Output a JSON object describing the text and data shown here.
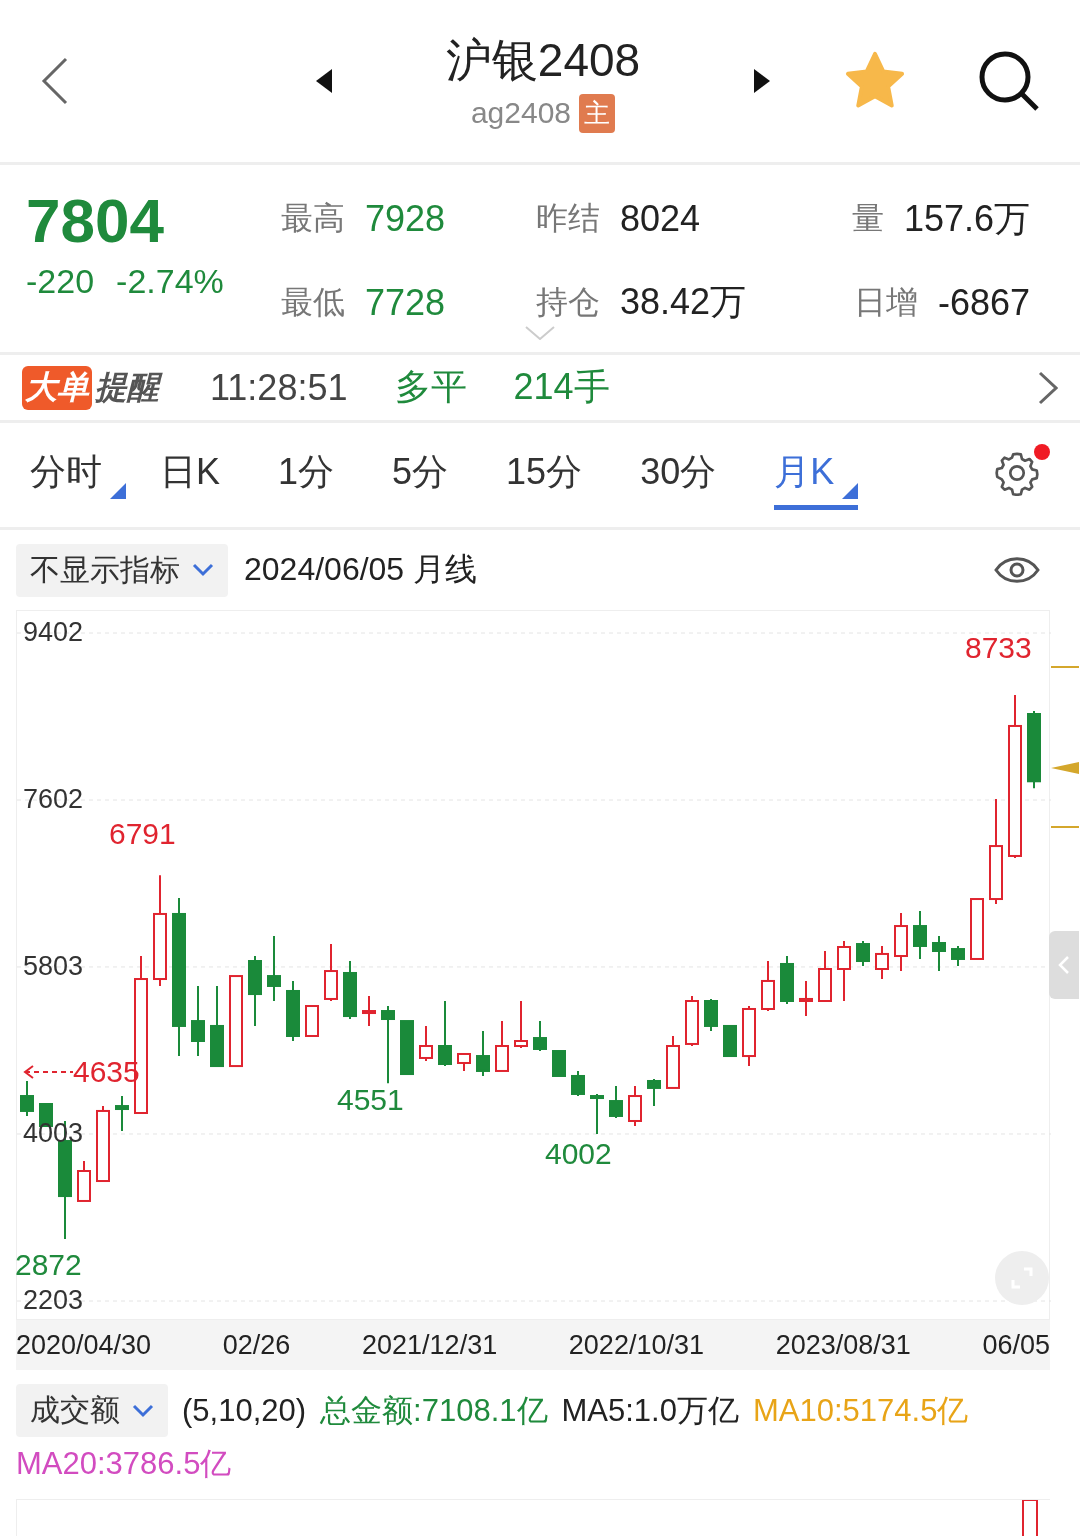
{
  "header": {
    "title": "沪银2408",
    "code": "ag2408",
    "badge": "主",
    "favorite": true
  },
  "quote": {
    "price": "7804",
    "change": "-220",
    "change_pct": "-2.74%",
    "stats": [
      {
        "label": "最高",
        "value": "7928",
        "kind": "price"
      },
      {
        "label": "昨结",
        "value": "8024",
        "kind": "plain"
      },
      {
        "label": "量",
        "value": "157.6万",
        "kind": "plain"
      },
      {
        "label": "最低",
        "value": "7728",
        "kind": "price"
      },
      {
        "label": "持仓",
        "value": "38.42万",
        "kind": "plain"
      },
      {
        "label": "日增",
        "value": "-6867",
        "kind": "plain"
      }
    ]
  },
  "alert": {
    "tag_1": "大单",
    "tag_2": "提醒",
    "time": "11:28:51",
    "action": "多平",
    "volume": "214手"
  },
  "tabs": [
    {
      "label": "分时",
      "selected": false,
      "menu": true
    },
    {
      "label": "日K",
      "selected": false,
      "menu": false
    },
    {
      "label": "1分",
      "selected": false,
      "menu": false
    },
    {
      "label": "5分",
      "selected": false,
      "menu": false
    },
    {
      "label": "15分",
      "selected": false,
      "menu": false
    },
    {
      "label": "30分",
      "selected": false,
      "menu": false
    },
    {
      "label": "月K",
      "selected": true,
      "menu": true
    }
  ],
  "settings_notice": true,
  "indicator": {
    "dropdown": "不显示指标",
    "date": "2024/06/05",
    "period": "月线"
  },
  "chart": {
    "chart_data": {
      "type": "candlestick",
      "ohlc": [
        [
          4412,
          4574,
          4197,
          4251
        ],
        [
          4326,
          4326,
          4089,
          4089
        ],
        [
          3927,
          4143,
          2872,
          3334
        ],
        [
          3281,
          3712,
          3281,
          3604
        ],
        [
          3496,
          4304,
          3496,
          4251
        ],
        [
          4304,
          4412,
          4035,
          4272
        ],
        [
          4229,
          5921,
          4229,
          5673
        ],
        [
          5673,
          6791,
          5598,
          6374
        ],
        [
          6374,
          6546,
          4843,
          5167
        ],
        [
          5220,
          5598,
          4843,
          5005
        ],
        [
          5167,
          5598,
          4735,
          4735
        ],
        [
          4735,
          5705,
          4735,
          5705
        ],
        [
          5867,
          5921,
          5167,
          5511
        ],
        [
          5705,
          6137,
          5436,
          5598
        ],
        [
          5544,
          5652,
          5005,
          5059
        ],
        [
          5059,
          5382,
          5059,
          5382
        ],
        [
          5458,
          6050,
          5436,
          5759
        ],
        [
          5738,
          5867,
          5242,
          5274
        ],
        [
          5307,
          5490,
          5167,
          5328
        ],
        [
          5328,
          5382,
          4551,
          5242
        ],
        [
          5220,
          5220,
          4649,
          4649
        ],
        [
          4822,
          5167,
          4789,
          4951
        ],
        [
          4951,
          5436,
          4735,
          4757
        ],
        [
          4768,
          4865,
          4682,
          4865
        ],
        [
          4843,
          5113,
          4628,
          4682
        ],
        [
          4682,
          5220,
          4682,
          4951
        ],
        [
          4951,
          5436,
          4929,
          5005
        ],
        [
          5037,
          5220,
          4897,
          4919
        ],
        [
          4897,
          4897,
          4628,
          4628
        ],
        [
          4628,
          4682,
          4412,
          4434
        ],
        [
          4412,
          4434,
          4002,
          4391
        ],
        [
          4358,
          4520,
          4175,
          4197
        ],
        [
          4143,
          4520,
          4089,
          4412
        ],
        [
          4574,
          4595,
          4304,
          4499
        ],
        [
          4499,
          5059,
          4499,
          4951
        ],
        [
          4973,
          5490,
          4951,
          5436
        ],
        [
          5436,
          5458,
          5113,
          5167
        ],
        [
          5167,
          5167,
          4843,
          4843
        ],
        [
          4843,
          5382,
          4735,
          5350
        ],
        [
          5350,
          5867,
          5328,
          5652
        ],
        [
          5835,
          5921,
          5404,
          5436
        ],
        [
          5436,
          5652,
          5274,
          5458
        ],
        [
          5436,
          5975,
          5436,
          5781
        ],
        [
          5781,
          6083,
          5436,
          6018
        ],
        [
          6050,
          6083,
          5813,
          5867
        ],
        [
          5781,
          6029,
          5673,
          5943
        ],
        [
          5921,
          6384,
          5759,
          6244
        ],
        [
          6244,
          6406,
          5889,
          6029
        ],
        [
          6061,
          6137,
          5759,
          5975
        ],
        [
          5996,
          6029,
          5813,
          5889
        ],
        [
          5889,
          6535,
          5889,
          6535
        ],
        [
          6535,
          7613,
          6481,
          7106
        ],
        [
          6999,
          8733,
          6977,
          8400
        ],
        [
          8529,
          8561,
          7728,
          7804
        ]
      ],
      "yticks": [
        9402,
        7602,
        5803,
        4003,
        2203
      ],
      "ylim": [
        2203,
        9402
      ],
      "grid": true
    },
    "x_labels": [
      "2020/04/30",
      "02/26",
      "2021/12/31",
      "2022/10/31",
      "2023/08/31",
      "06/05"
    ],
    "annotations": [
      {
        "text": "8733",
        "kind": "high"
      },
      {
        "text": "6791",
        "kind": "high"
      },
      {
        "text": "4635",
        "kind": "marker"
      },
      {
        "text": "4551",
        "kind": "low"
      },
      {
        "text": "4002",
        "kind": "low"
      },
      {
        "text": "2872",
        "kind": "low"
      }
    ]
  },
  "volume": {
    "dropdown": "成交额",
    "params": "(5,10,20)",
    "items": [
      {
        "text": "总金额:7108.1亿",
        "color": "#1f8a3c"
      },
      {
        "text": "MA5:1.0万亿",
        "color": "#222222"
      },
      {
        "text": "MA10:5174.5亿",
        "color": "#e8a417"
      },
      {
        "text": "MA20:3786.5亿",
        "color": "#d24cc0"
      }
    ]
  }
}
